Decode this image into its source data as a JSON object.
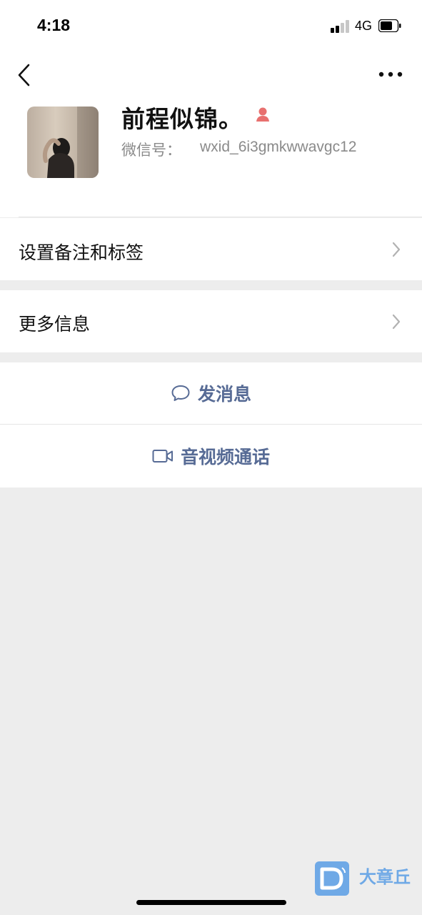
{
  "status_bar": {
    "time": "4:18",
    "network": "4G",
    "signal_bars_active": 2,
    "signal_bars_total": 4,
    "battery_level": 0.6
  },
  "nav": {
    "back_icon": "chevron-left-icon",
    "more_icon": "more-dots-icon"
  },
  "profile": {
    "nickname": "前程似锦。",
    "gender_icon": "female-icon",
    "wechat_id_label": "微信号：",
    "wechat_id": "wxid_6i3gmkwwavgc12"
  },
  "menu": {
    "remark_tags_label": "设置备注和标签",
    "more_info_label": "更多信息"
  },
  "actions": {
    "message_label": "发消息",
    "video_call_label": "音视频通话"
  },
  "watermark": {
    "brand": "大章丘",
    "logo_letter": "D"
  },
  "colors": {
    "accent_link": "#576b95",
    "background": "#ededed",
    "gender_female": "#e8706f",
    "watermark": "#6fa9e6"
  }
}
